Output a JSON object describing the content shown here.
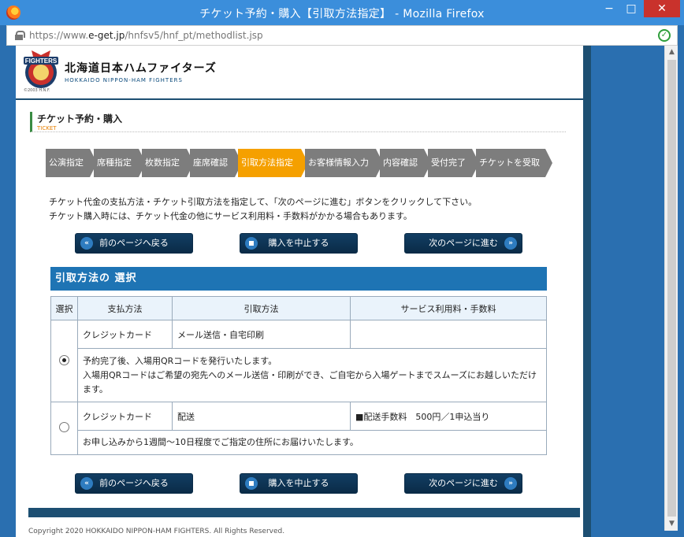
{
  "window": {
    "title": "チケット予約・購入【引取方法指定】 - Mozilla Firefox",
    "min": "−",
    "max": "□",
    "close": "✕"
  },
  "urlbar": {
    "prefix": "https://www.",
    "domain": "e-get.jp",
    "path": "/hnfsv5/hnf_pt/methodlist.jsp"
  },
  "header": {
    "logo_ja": "北海道日本ハムファイターズ",
    "logo_en": "HOKKAIDO NIPPON-HAM FIGHTERS",
    "logo_copy": "©2003 H.N.F."
  },
  "section": {
    "title": "チケット予約・購入",
    "sub": "TICKET"
  },
  "steps": [
    {
      "label": "公演指定"
    },
    {
      "label": "席種指定"
    },
    {
      "label": "枚数指定"
    },
    {
      "label": "座席確認"
    },
    {
      "label": "引取方法指定"
    },
    {
      "label": "お客様情報入力"
    },
    {
      "label": "内容確認"
    },
    {
      "label": "受付完了"
    },
    {
      "label": "チケットを受取る"
    }
  ],
  "instructions": {
    "line1": "チケット代金の支払方法・チケット引取方法を指定して、「次のページに進む」ボタンをクリックして下さい。",
    "line2": "チケット購入時には、チケット代金の他にサービス利用料・手数料がかかる場合もあります。"
  },
  "nav": {
    "back": "前のページへ戻る",
    "cancel": "購入を中止する",
    "next": "次のページに進む"
  },
  "panel": {
    "title": "引取方法の 選択"
  },
  "table": {
    "headers": [
      "選択",
      "支払方法",
      "引取方法",
      "サービス利用料・手数料"
    ],
    "rows": [
      {
        "payment": "クレジットカード",
        "method": "メール送信・自宅印刷",
        "fee": "",
        "desc1": "予約完了後、入場用QRコードを発行いたします。",
        "desc2": "入場用QRコードはご希望の宛先へのメール送信・印刷ができ、ご自宅から入場ゲートまでスムーズにお越しいただけます。"
      },
      {
        "payment": "クレジットカード",
        "method": "配送",
        "fee": "■配送手数料　500円／1申込当り",
        "desc1": "お申し込みから1週間～10日程度でご指定の住所にお届けいたします。"
      }
    ]
  },
  "footer": {
    "copyright": "Copyright 2020 HOKKAIDO NIPPON-HAM FIGHTERS. All Rights Reserved."
  },
  "colors": {
    "titlebar": "#3b8edb",
    "active_step": "#f5a000",
    "step": "#7d7d7d",
    "panel": "#1e74b4",
    "navy": "#0a2b47"
  }
}
